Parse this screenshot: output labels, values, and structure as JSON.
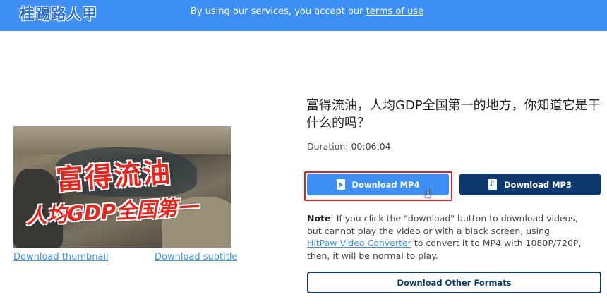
{
  "header": {
    "logo_text": "桂踢路人甲",
    "notice_prefix": "By using our services, you accept our ",
    "notice_link": "terms of use"
  },
  "video": {
    "thumbnail_caption_line1": "富得流油",
    "thumbnail_caption_line2": "人均GDP全国第一",
    "download_thumbnail": "Download thumbnail",
    "download_subtitle": "Download subtitle",
    "title": "富得流油，人均GDP全国第一的地方，你知道它是干什么的吗？",
    "duration": "Duration: 00:06:04"
  },
  "actions": {
    "mp4_label": "Download MP4",
    "mp3_label": "Download MP3",
    "other_formats_label": "Download Other Formats"
  },
  "note": {
    "label": "Note",
    "text_before_link": ": If you click the \"download\" button to download videos, but cannot play the video or with a black screen, using ",
    "link_text": "HitPaw Video Converter",
    "text_after_link": " to convert it to MP4 with 1080P/720P, then, it will be normal to play."
  },
  "colors": {
    "header_bg": "#3d8ff5",
    "primary_button": "#3d8ff5",
    "dark_button": "#0d3a6e",
    "highlight_border": "#d9262a"
  },
  "icons": {
    "mp4": "video-file-icon",
    "mp3": "music-file-icon",
    "cursor": "hand-pointer-icon"
  }
}
